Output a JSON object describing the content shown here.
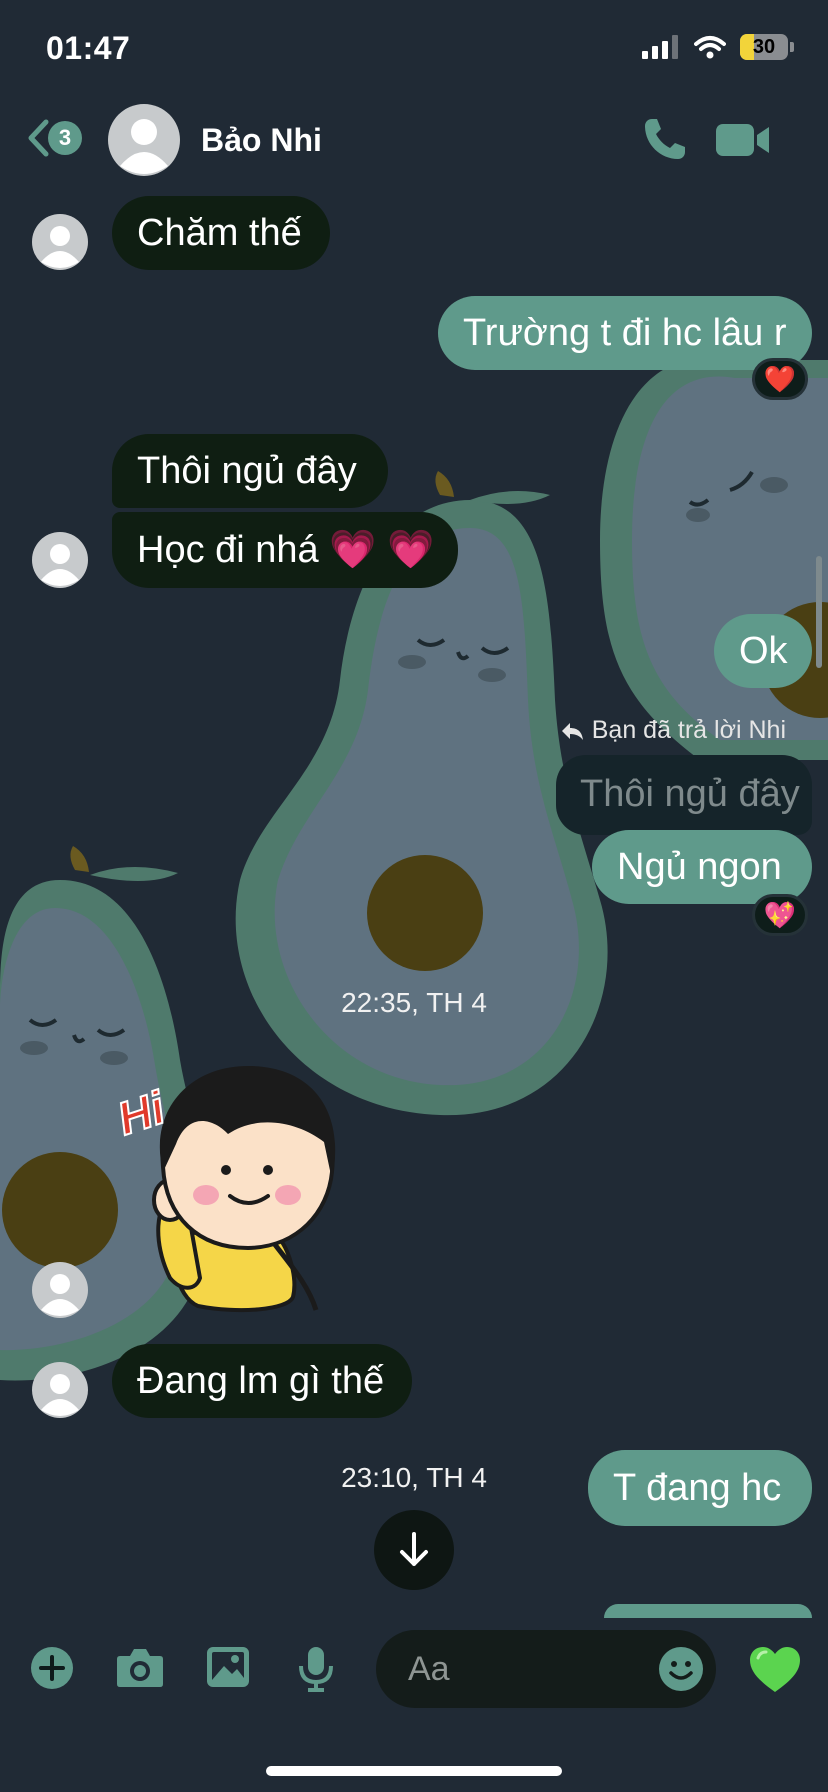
{
  "status_bar": {
    "time": "01:47",
    "battery": "30",
    "battery_level": 0.3
  },
  "header": {
    "back_badge": "3",
    "contact_name": "Bảo Nhi"
  },
  "messages": {
    "m1": "Chăm thế",
    "m2": "Trường t đi hc lâu r",
    "m2_reaction": "❤️",
    "m3": "Thôi ngủ đây",
    "m4": "Học đi nhá 💗 💗",
    "m5": "Ok",
    "reply_label": "Bạn đã trả lời Nhi",
    "reply_quote": "Thôi ngủ đây",
    "m6": "Ngủ ngon",
    "m6_reaction": "💖",
    "ts1": "22:35, TH 4",
    "sticker_text": "Hi",
    "m7": "Đang lm gì thế",
    "ts2": "23:10, TH 4",
    "m8": "T đang hc"
  },
  "composer": {
    "placeholder": "Aa",
    "like_emoji": "💚"
  },
  "colors": {
    "background": "#202a35",
    "incoming_bubble": "#0f1e12",
    "outgoing_bubble": "#5f9a8b",
    "accent": "#5f9a8b"
  },
  "icons": {
    "back": "chevron-left-icon",
    "call": "phone-icon",
    "video": "video-camera-icon",
    "add": "plus-circle-icon",
    "camera": "camera-icon",
    "gallery": "image-icon",
    "mic": "microphone-icon",
    "emoji": "smiley-icon",
    "scroll": "arrow-down-icon"
  }
}
